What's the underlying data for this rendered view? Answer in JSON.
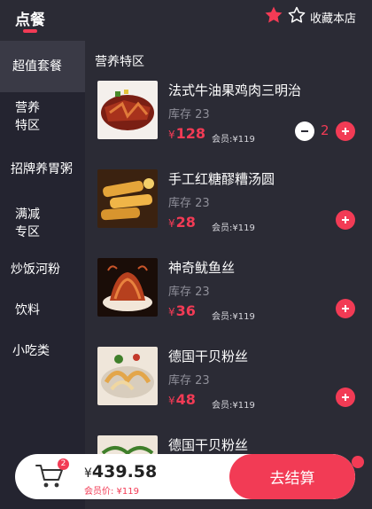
{
  "header": {
    "active_tab": "点餐",
    "favorite_label": "收藏本店"
  },
  "sidebar": {
    "items": [
      {
        "label": "超值套餐"
      },
      {
        "label": "营养\n特区"
      },
      {
        "label": "招牌养胃粥"
      },
      {
        "label": "满减\n专区"
      },
      {
        "label": "炒饭河粉"
      },
      {
        "label": "饮料"
      },
      {
        "label": "小吃类"
      }
    ]
  },
  "main": {
    "section_title": "营养特区",
    "items": [
      {
        "name": "法式牛油果鸡肉三明治",
        "stock": "库存 23",
        "currency": "¥",
        "price": "128",
        "member_price": "会员:¥119",
        "quantity": "2"
      },
      {
        "name": "手工红糖醪糟汤圆",
        "stock": "库存 23",
        "currency": "¥",
        "price": "28",
        "member_price": "会员:¥119"
      },
      {
        "name": "神奇鱿鱼丝",
        "stock": "库存 23",
        "currency": "¥",
        "price": "36",
        "member_price": "会员:¥119"
      },
      {
        "name": "德国干贝粉丝",
        "stock": "库存 23",
        "currency": "¥",
        "price": "48",
        "member_price": "会员:¥119"
      },
      {
        "name": "德国干贝粉丝"
      }
    ]
  },
  "cart": {
    "badge_count": "2",
    "currency": "¥",
    "total": "439.58",
    "member_total": "会员价: ¥119",
    "checkout_label": "去结算"
  },
  "colors": {
    "accent": "#f23b55",
    "background": "#2b2b35",
    "sidebar_bg": "#242430",
    "sidebar_active": "#3a3a46"
  }
}
